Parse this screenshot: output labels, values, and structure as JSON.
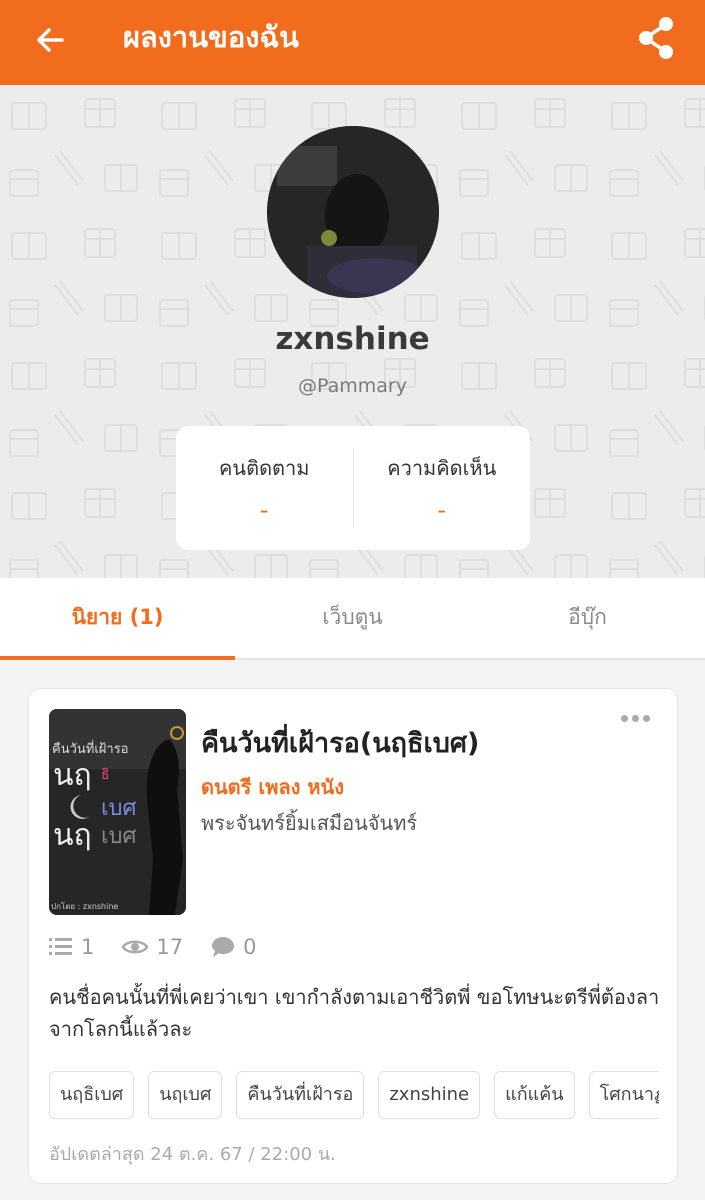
{
  "header": {
    "title": "ผลงานของฉัน"
  },
  "profile": {
    "display_name": "zxnshine",
    "handle": "@Pammary",
    "stats": [
      {
        "label": "คนติดตาม",
        "value": "-"
      },
      {
        "label": "ความคิดเห็น",
        "value": "-"
      }
    ]
  },
  "tabs": [
    {
      "label": "นิยาย (1)",
      "active": true
    },
    {
      "label": "เว็บตูน",
      "active": false
    },
    {
      "label": "อีบุ๊ก",
      "active": false
    }
  ],
  "novel": {
    "title": "คืนวันที่เฝ้ารอ(นฤธิเบศ)",
    "genre": "ดนตรี เพลง หนัง",
    "author": "พระจันทร์ยิ้มเสมือนจันทร์",
    "chapters": "1",
    "views": "17",
    "comments": "0",
    "description": "คนชื่อคนนั้นที่พี่เคยว่าเขา เขากำลังตามเอาชีวิตพี่  ขอโทษนะตรีพี่ต้องลาจากโลกนี้แล้วละ",
    "tags": [
      "นฤธิเบศ",
      "นฤเบศ",
      "คืนวันที่เฝ้ารอ",
      "zxnshine",
      "แก้แค้น",
      "โศกนาฏกรรม"
    ],
    "updated": "อัปเดตล่าสุด 24 ต.ค. 67 / 22:00 น.",
    "cover": {
      "title": "คืนวันที่เฝ้ารอ",
      "line1": "นฤ",
      "line1b": "ธิ",
      "line2": "เบศ",
      "line3": "นฤ",
      "line3b": "เบศ",
      "credit": "ปกโดย : zxnshine"
    }
  },
  "colors": {
    "accent": "#f26c1d"
  }
}
